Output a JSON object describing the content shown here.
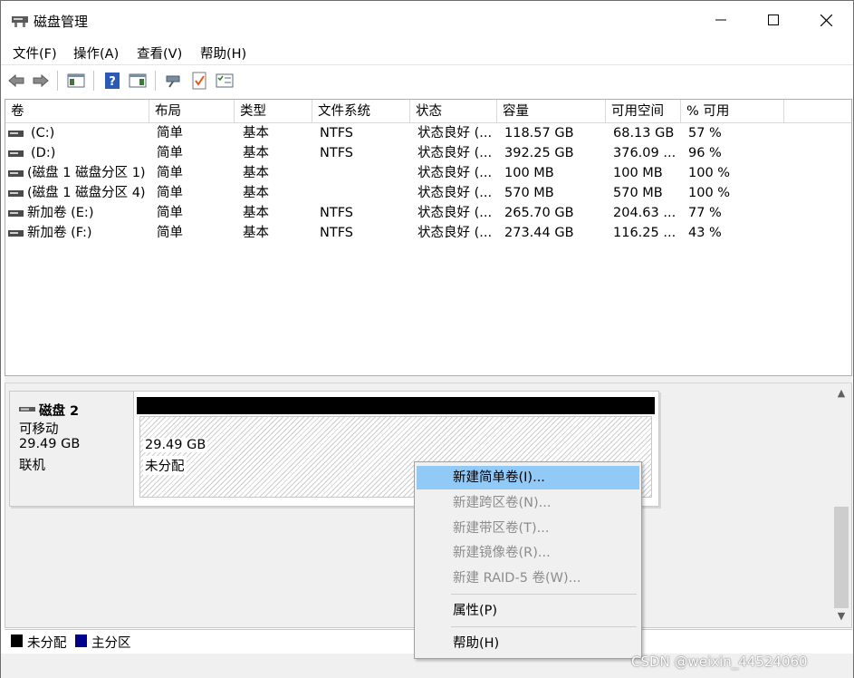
{
  "window": {
    "title": "磁盘管理"
  },
  "menu": [
    "文件(F)",
    "操作(A)",
    "查看(V)",
    "帮助(H)"
  ],
  "toolbar_icons": [
    "back-arrow-icon",
    "forward-arrow-icon",
    "console-tree-icon",
    "help-icon",
    "action-pane-icon",
    "connect-icon",
    "check-icon",
    "properties-icon"
  ],
  "columns": [
    "卷",
    "布局",
    "类型",
    "文件系统",
    "状态",
    "容量",
    "可用空间",
    "% 可用"
  ],
  "volumes": [
    {
      "name": "(C:)",
      "layout": "简单",
      "type": "基本",
      "fs": "NTFS",
      "status": "状态良好 (...",
      "capacity": "118.57 GB",
      "free": "68.13 GB",
      "pct": "57 %"
    },
    {
      "name": "(D:)",
      "layout": "简单",
      "type": "基本",
      "fs": "NTFS",
      "status": "状态良好 (...",
      "capacity": "392.25 GB",
      "free": "376.09 ...",
      "pct": "96 %"
    },
    {
      "name": "(磁盘 1 磁盘分区 1)",
      "layout": "简单",
      "type": "基本",
      "fs": "",
      "status": "状态良好 (...",
      "capacity": "100 MB",
      "free": "100 MB",
      "pct": "100 %"
    },
    {
      "name": "(磁盘 1 磁盘分区 4)",
      "layout": "简单",
      "type": "基本",
      "fs": "",
      "status": "状态良好 (...",
      "capacity": "570 MB",
      "free": "570 MB",
      "pct": "100 %"
    },
    {
      "name": "新加卷 (E:)",
      "layout": "简单",
      "type": "基本",
      "fs": "NTFS",
      "status": "状态良好 (...",
      "capacity": "265.70 GB",
      "free": "204.63 ...",
      "pct": "77 %"
    },
    {
      "name": "新加卷 (F:)",
      "layout": "简单",
      "type": "基本",
      "fs": "NTFS",
      "status": "状态良好 (...",
      "capacity": "273.44 GB",
      "free": "116.25 ...",
      "pct": "43 %"
    }
  ],
  "disk": {
    "name": "磁盘 2",
    "kind": "可移动",
    "size": "29.49 GB",
    "state": "联机",
    "partition": {
      "size": "29.49 GB",
      "label": "未分配"
    }
  },
  "context_menu": {
    "items": [
      {
        "label": "新建简单卷(I)...",
        "enabled": true,
        "highlighted": true
      },
      {
        "label": "新建跨区卷(N)...",
        "enabled": false
      },
      {
        "label": "新建带区卷(T)...",
        "enabled": false
      },
      {
        "label": "新建镜像卷(R)...",
        "enabled": false
      },
      {
        "label": "新建 RAID-5 卷(W)...",
        "enabled": false
      }
    ],
    "properties": "属性(P)",
    "help": "帮助(H)"
  },
  "legend": [
    {
      "label": "未分配",
      "color": "#000000"
    },
    {
      "label": "主分区",
      "color": "#00008b"
    }
  ],
  "colors": {
    "highlight": "#91c9f7",
    "unallocated_bar": "#000000",
    "primary_partition": "#00008b"
  },
  "watermark": "CSDN @weixin_44524060"
}
